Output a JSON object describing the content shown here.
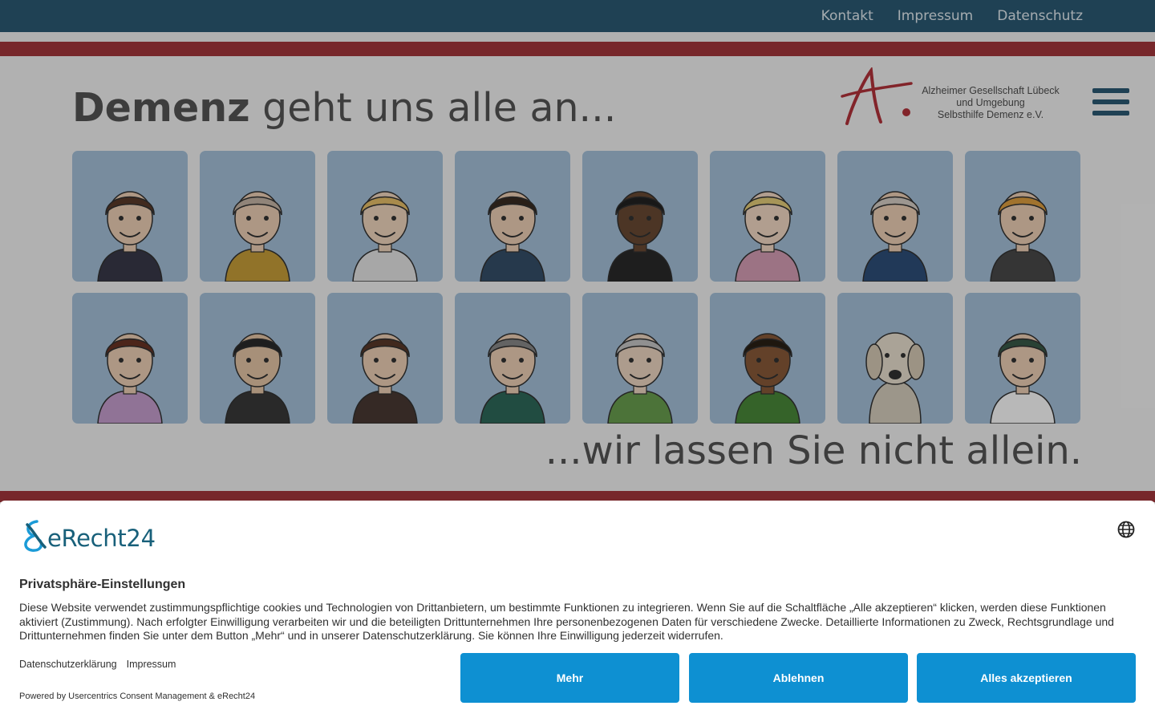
{
  "topnav": {
    "kontakt": "Kontakt",
    "impressum": "Impressum",
    "datenschutz": "Datenschutz"
  },
  "hero": {
    "title_bold": "Demenz",
    "title_rest": " geht uns alle an...",
    "subtitle": "...wir lassen Sie nicht allein.",
    "org_line1": "Alzheimer Gesellschaft Lübeck",
    "org_line2": "und Umgebung",
    "org_line3": "Selbsthilfe Demenz e.V."
  },
  "colors": {
    "top_bar": "#2c5a75",
    "stripe": "#a5363c",
    "tile_bg": "#a7c3dc",
    "button": "#0e90d2",
    "brand": "#18607a"
  },
  "avatars": [
    "woman-bob-hair",
    "bald-man-yellow-sweater",
    "nurse",
    "young-man-headphones",
    "man-sunglasses",
    "little-girl-bow",
    "mechanic-wrench",
    "woman-curly-blonde",
    "hairdresser-scissors",
    "man-glasses-goatee",
    "woman-glasses",
    "grey-haired-woman",
    "elderly-woman-glasses",
    "child-dreadlocks",
    "dog",
    "police-officer"
  ],
  "consent": {
    "brand": "eRecht24",
    "title": "Privatsphäre-Einstellungen",
    "text": "Diese Website verwendet zustimmungspflichtige cookies und Technologien von Drittanbietern, um bestimmte Funktionen zu integrieren. Wenn Sie auf die Schaltfläche „Alle akzeptieren“ klicken, werden diese Funktionen aktiviert (Zustimmung). Nach erfolgter Einwilligung verarbeiten wir und die beteiligten Drittunternehmen Ihre personenbezogenen Daten für verschiedene Zwecke. Detaillierte Informationen zu Zweck, Rechtsgrundlage und Drittunternehmen finden Sie unter dem Button „Mehr“ und in unserer Datenschutzerklärung. Sie können Ihre Einwilligung jederzeit widerrufen.",
    "link_privacy": "Datenschutzerklärung",
    "link_imprint": "Impressum",
    "powered": "Powered by Usercentrics Consent Management & eRecht24",
    "btn_more": "Mehr",
    "btn_decline": "Ablehnen",
    "btn_accept": "Alles akzeptieren"
  }
}
